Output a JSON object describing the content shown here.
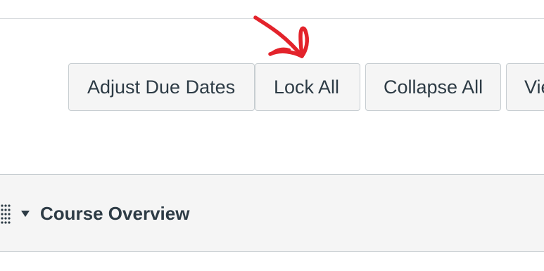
{
  "toolbar": {
    "adjust_due_dates_label": "Adjust Due Dates",
    "lock_all_label": "Lock All",
    "collapse_all_label": "Collapse All",
    "view_label": "Vie"
  },
  "module": {
    "title": "Course Overview",
    "expanded": true
  },
  "icons": {
    "drag_handle": "drag-handle-icon",
    "toggle": "triangle-down-icon",
    "annotation": "red-arrow-annotation"
  },
  "colors": {
    "text": "#2d3b45",
    "button_bg": "#f5f5f5",
    "button_border": "#c7cdd1",
    "annotation": "#e3232b"
  }
}
